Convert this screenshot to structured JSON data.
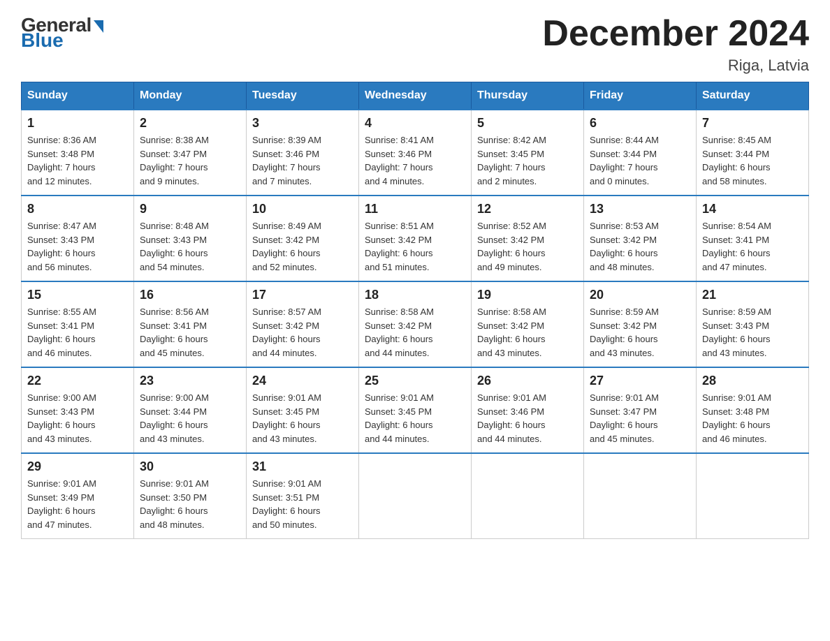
{
  "logo": {
    "general_text": "General",
    "blue_text": "Blue"
  },
  "header": {
    "title": "December 2024",
    "location": "Riga, Latvia"
  },
  "weekdays": [
    "Sunday",
    "Monday",
    "Tuesday",
    "Wednesday",
    "Thursday",
    "Friday",
    "Saturday"
  ],
  "weeks": [
    [
      {
        "day": "1",
        "info": "Sunrise: 8:36 AM\nSunset: 3:48 PM\nDaylight: 7 hours\nand 12 minutes."
      },
      {
        "day": "2",
        "info": "Sunrise: 8:38 AM\nSunset: 3:47 PM\nDaylight: 7 hours\nand 9 minutes."
      },
      {
        "day": "3",
        "info": "Sunrise: 8:39 AM\nSunset: 3:46 PM\nDaylight: 7 hours\nand 7 minutes."
      },
      {
        "day": "4",
        "info": "Sunrise: 8:41 AM\nSunset: 3:46 PM\nDaylight: 7 hours\nand 4 minutes."
      },
      {
        "day": "5",
        "info": "Sunrise: 8:42 AM\nSunset: 3:45 PM\nDaylight: 7 hours\nand 2 minutes."
      },
      {
        "day": "6",
        "info": "Sunrise: 8:44 AM\nSunset: 3:44 PM\nDaylight: 7 hours\nand 0 minutes."
      },
      {
        "day": "7",
        "info": "Sunrise: 8:45 AM\nSunset: 3:44 PM\nDaylight: 6 hours\nand 58 minutes."
      }
    ],
    [
      {
        "day": "8",
        "info": "Sunrise: 8:47 AM\nSunset: 3:43 PM\nDaylight: 6 hours\nand 56 minutes."
      },
      {
        "day": "9",
        "info": "Sunrise: 8:48 AM\nSunset: 3:43 PM\nDaylight: 6 hours\nand 54 minutes."
      },
      {
        "day": "10",
        "info": "Sunrise: 8:49 AM\nSunset: 3:42 PM\nDaylight: 6 hours\nand 52 minutes."
      },
      {
        "day": "11",
        "info": "Sunrise: 8:51 AM\nSunset: 3:42 PM\nDaylight: 6 hours\nand 51 minutes."
      },
      {
        "day": "12",
        "info": "Sunrise: 8:52 AM\nSunset: 3:42 PM\nDaylight: 6 hours\nand 49 minutes."
      },
      {
        "day": "13",
        "info": "Sunrise: 8:53 AM\nSunset: 3:42 PM\nDaylight: 6 hours\nand 48 minutes."
      },
      {
        "day": "14",
        "info": "Sunrise: 8:54 AM\nSunset: 3:41 PM\nDaylight: 6 hours\nand 47 minutes."
      }
    ],
    [
      {
        "day": "15",
        "info": "Sunrise: 8:55 AM\nSunset: 3:41 PM\nDaylight: 6 hours\nand 46 minutes."
      },
      {
        "day": "16",
        "info": "Sunrise: 8:56 AM\nSunset: 3:41 PM\nDaylight: 6 hours\nand 45 minutes."
      },
      {
        "day": "17",
        "info": "Sunrise: 8:57 AM\nSunset: 3:42 PM\nDaylight: 6 hours\nand 44 minutes."
      },
      {
        "day": "18",
        "info": "Sunrise: 8:58 AM\nSunset: 3:42 PM\nDaylight: 6 hours\nand 44 minutes."
      },
      {
        "day": "19",
        "info": "Sunrise: 8:58 AM\nSunset: 3:42 PM\nDaylight: 6 hours\nand 43 minutes."
      },
      {
        "day": "20",
        "info": "Sunrise: 8:59 AM\nSunset: 3:42 PM\nDaylight: 6 hours\nand 43 minutes."
      },
      {
        "day": "21",
        "info": "Sunrise: 8:59 AM\nSunset: 3:43 PM\nDaylight: 6 hours\nand 43 minutes."
      }
    ],
    [
      {
        "day": "22",
        "info": "Sunrise: 9:00 AM\nSunset: 3:43 PM\nDaylight: 6 hours\nand 43 minutes."
      },
      {
        "day": "23",
        "info": "Sunrise: 9:00 AM\nSunset: 3:44 PM\nDaylight: 6 hours\nand 43 minutes."
      },
      {
        "day": "24",
        "info": "Sunrise: 9:01 AM\nSunset: 3:45 PM\nDaylight: 6 hours\nand 43 minutes."
      },
      {
        "day": "25",
        "info": "Sunrise: 9:01 AM\nSunset: 3:45 PM\nDaylight: 6 hours\nand 44 minutes."
      },
      {
        "day": "26",
        "info": "Sunrise: 9:01 AM\nSunset: 3:46 PM\nDaylight: 6 hours\nand 44 minutes."
      },
      {
        "day": "27",
        "info": "Sunrise: 9:01 AM\nSunset: 3:47 PM\nDaylight: 6 hours\nand 45 minutes."
      },
      {
        "day": "28",
        "info": "Sunrise: 9:01 AM\nSunset: 3:48 PM\nDaylight: 6 hours\nand 46 minutes."
      }
    ],
    [
      {
        "day": "29",
        "info": "Sunrise: 9:01 AM\nSunset: 3:49 PM\nDaylight: 6 hours\nand 47 minutes."
      },
      {
        "day": "30",
        "info": "Sunrise: 9:01 AM\nSunset: 3:50 PM\nDaylight: 6 hours\nand 48 minutes."
      },
      {
        "day": "31",
        "info": "Sunrise: 9:01 AM\nSunset: 3:51 PM\nDaylight: 6 hours\nand 50 minutes."
      },
      null,
      null,
      null,
      null
    ]
  ]
}
